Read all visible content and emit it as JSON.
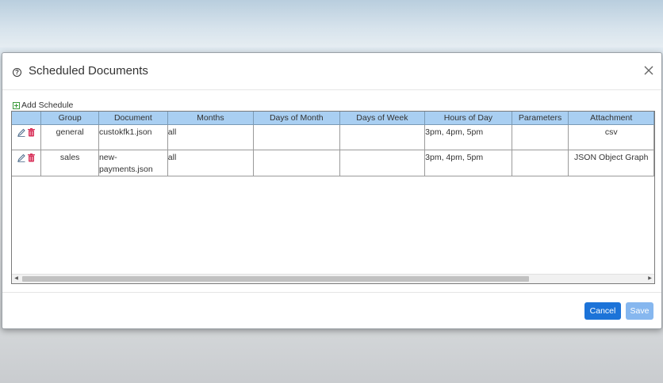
{
  "dialog": {
    "title": "Scheduled Documents",
    "help_icon": "question-circle-icon",
    "close_icon": "close-icon"
  },
  "toolbar": {
    "add_schedule_label": "Add Schedule",
    "add_icon": "plus-square-icon"
  },
  "table": {
    "headers": [
      "",
      "Group",
      "Document",
      "Months",
      "Days of Month",
      "Days of Week",
      "Hours of Day",
      "Parameters",
      "Attachment"
    ],
    "rows": [
      {
        "group": "general",
        "document": "custokfk1.json",
        "months": "all",
        "days_of_month": "",
        "days_of_week": "",
        "hours_of_day": "3pm, 4pm, 5pm",
        "parameters": "",
        "attachment": "csv"
      },
      {
        "group": "sales",
        "document": "new-\npayments.json",
        "months": "all",
        "days_of_month": "",
        "days_of_week": "",
        "hours_of_day": "3pm, 4pm, 5pm",
        "parameters": "",
        "attachment": "JSON Object Graph"
      }
    ],
    "row_icons": [
      "edit-icon",
      "delete-icon"
    ]
  },
  "footer": {
    "cancel_label": "Cancel",
    "save_label": "Save"
  },
  "colors": {
    "header_bg": "#a9cff2",
    "primary": "#1c73d8",
    "primary_disabled": "#86b7ef",
    "add_icon": "#3a9a3a",
    "delete_icon": "#d8335b"
  }
}
